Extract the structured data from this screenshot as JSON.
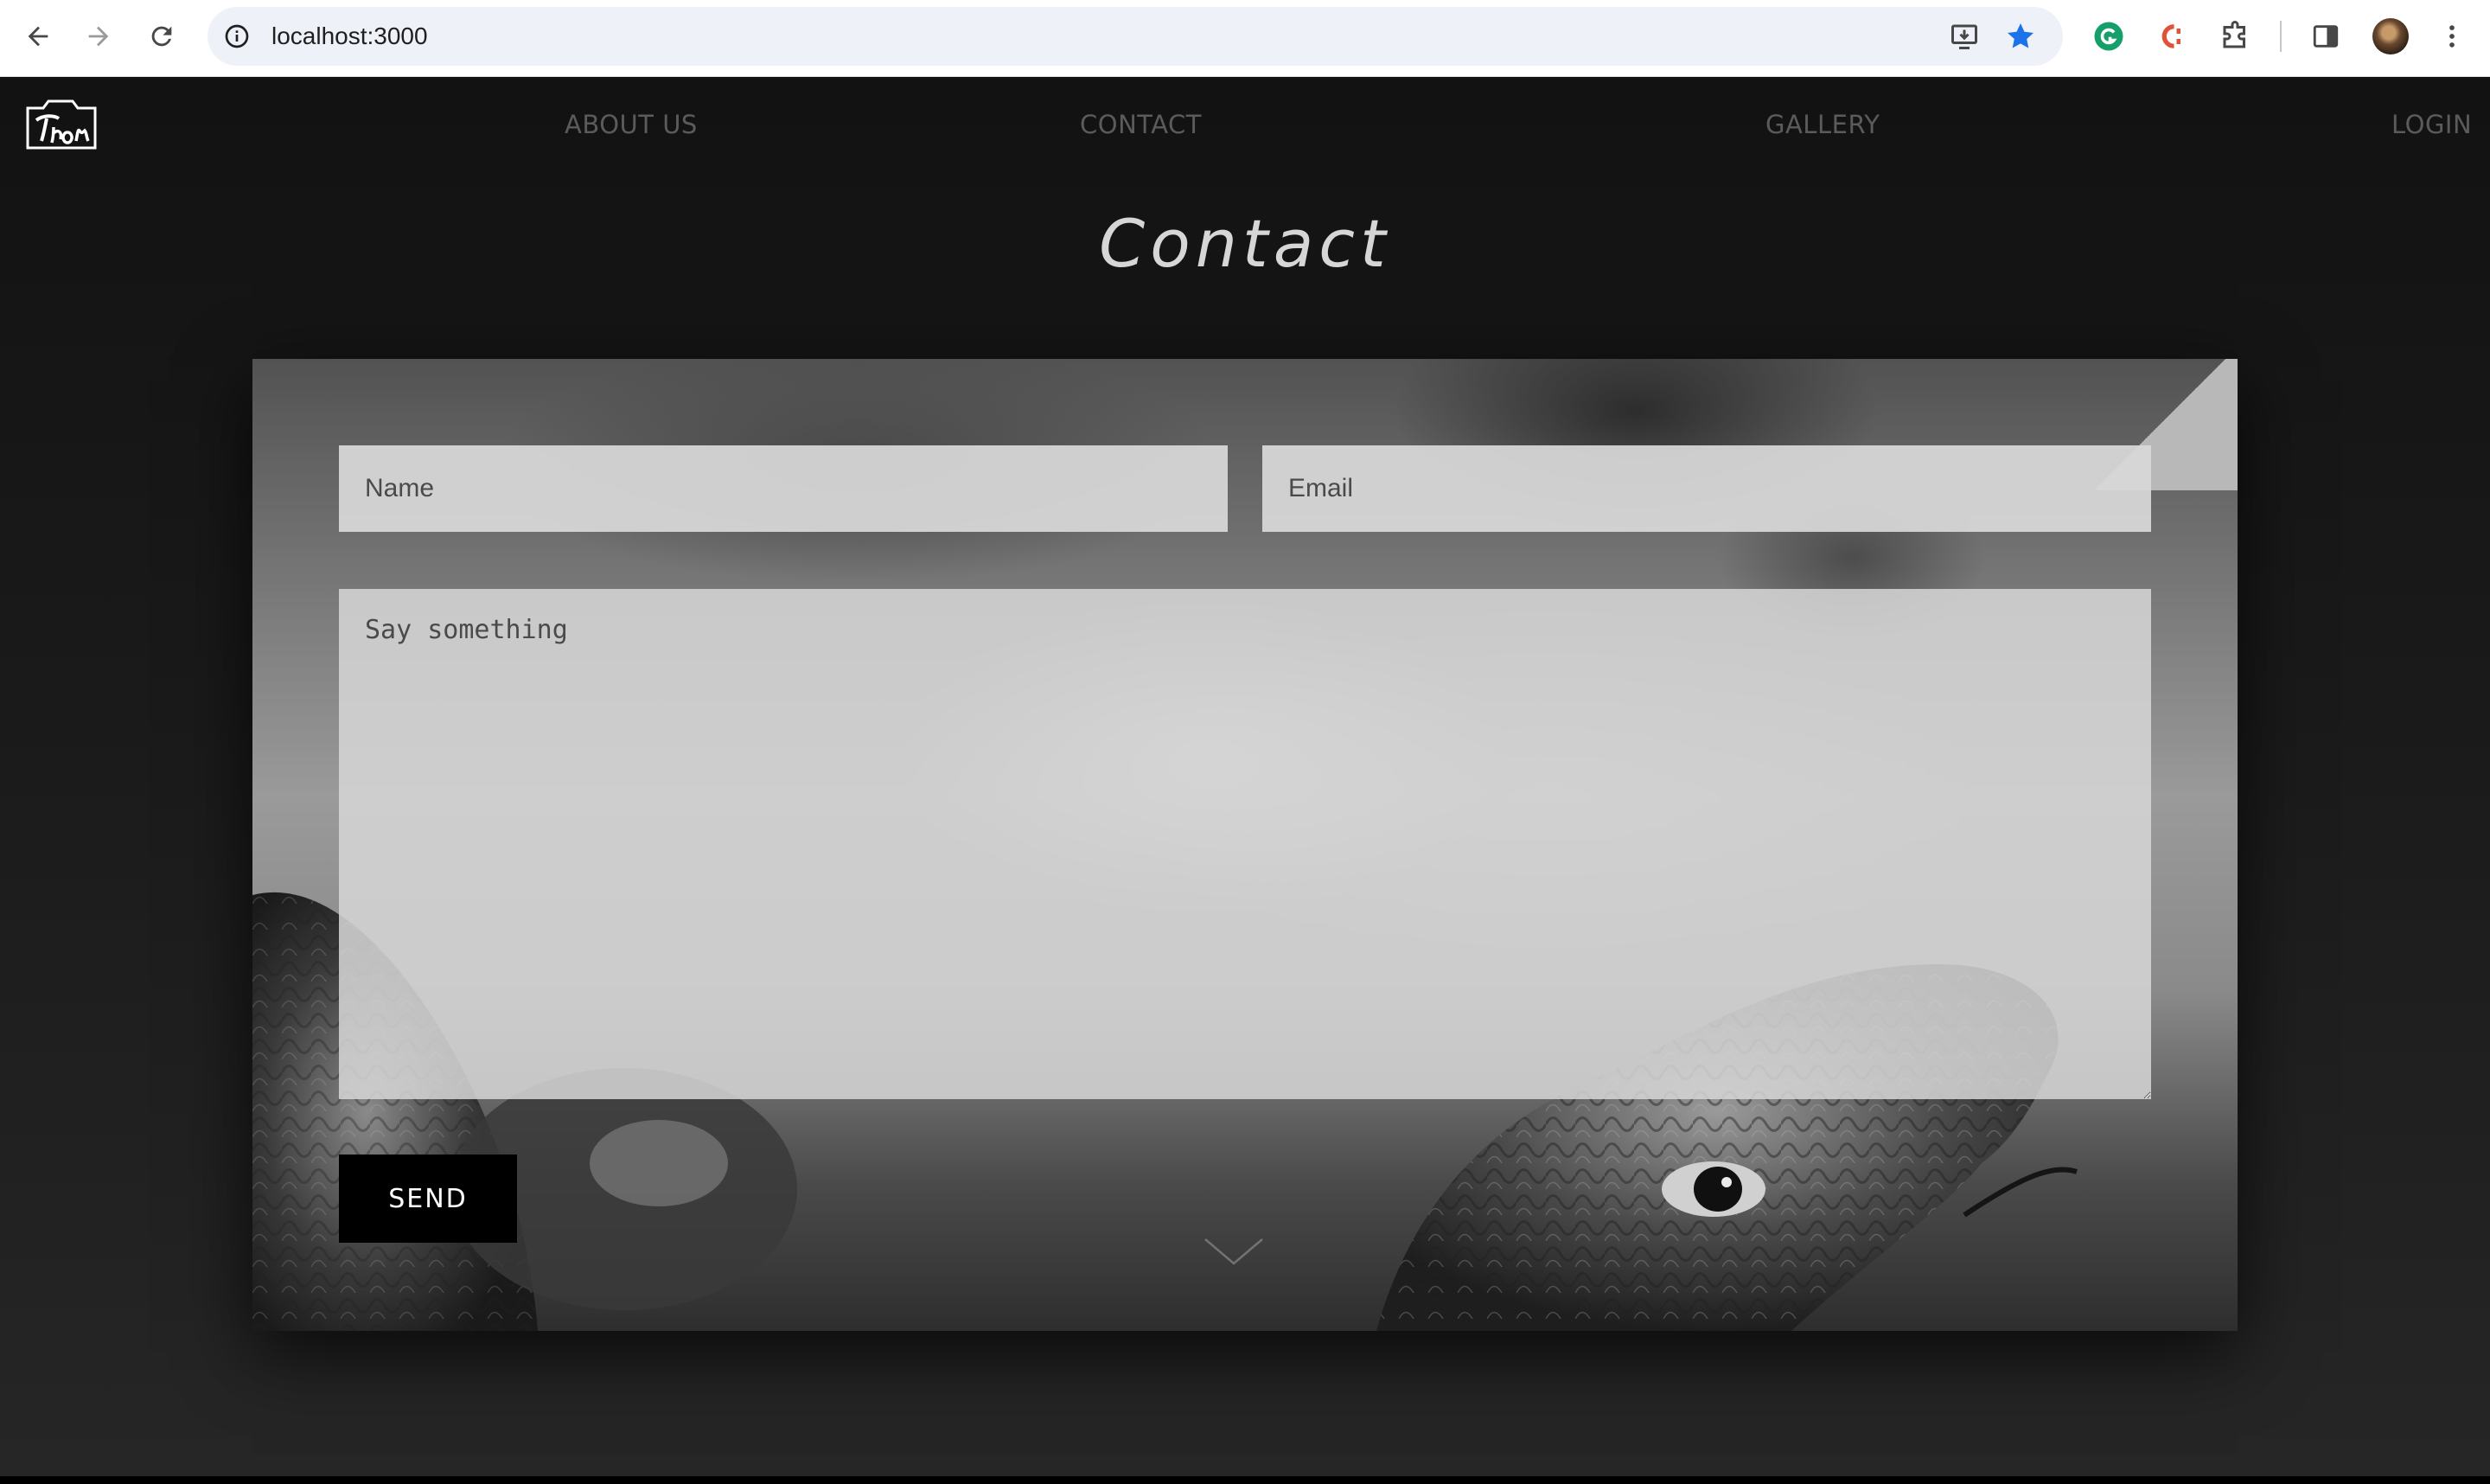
{
  "browser": {
    "url": "localhost:3000",
    "icons": [
      "back-icon",
      "forward-icon",
      "reload-icon",
      "site-info-icon",
      "install-app-icon",
      "bookmark-star-icon",
      "grammarly-icon",
      "color-picker-extension-icon",
      "extensions-puzzle-icon",
      "side-panel-icon",
      "profile-avatar",
      "menu-kebab-icon"
    ],
    "colors": {
      "bookmark_star": "#1a73e8",
      "grammarly": "#15a06a",
      "extension_red": "#e0533b"
    }
  },
  "site": {
    "logo_alt": "Thom",
    "nav": {
      "about": "ABOUT US",
      "contact": "CONTACT",
      "gallery": "GALLERY",
      "login": "LOGIN"
    },
    "title": "Contact"
  },
  "contact_form": {
    "name_placeholder": "Name",
    "email_placeholder": "Email",
    "message_placeholder": "Say something",
    "send_label": "SEND",
    "scroll_hint_icon": "chevron-down-icon"
  },
  "colors": {
    "page_background": "#1a1a1a",
    "field_background": "#d8d8d8",
    "button_background": "#000000",
    "title_text": "#d6d6d6",
    "nav_text": "#5b5b5b"
  }
}
